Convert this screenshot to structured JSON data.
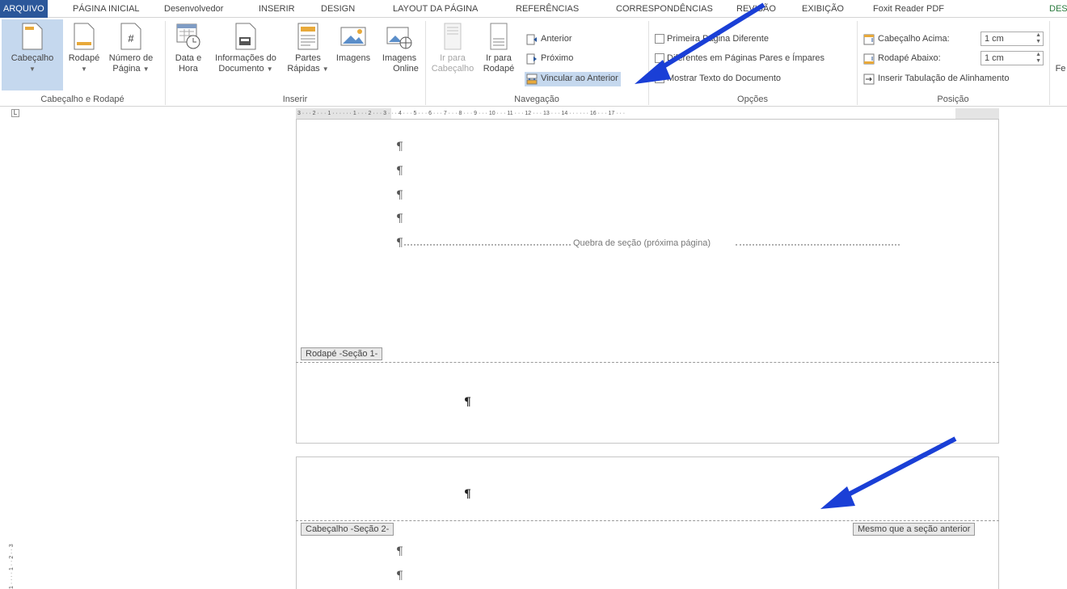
{
  "tabs": [
    "ARQUIVO",
    "PÁGINA INICIAL",
    "Desenvolvedor",
    "INSERIR",
    "DESIGN",
    "LAYOUT DA PÁGINA",
    "REFERÊNCIAS",
    "CORRESPONDÊNCIAS",
    "REVISÃO",
    "EXIBIÇÃO",
    "Foxit Reader PDF",
    "DES"
  ],
  "ribbon": {
    "header_footer_group": {
      "label": "Cabeçalho e Rodapé",
      "header_btn": "Cabeçalho",
      "footer_btn": "Rodapé",
      "page_number_btn_1": "Número de",
      "page_number_btn_2": "Página"
    },
    "insert_group": {
      "label": "Inserir",
      "datetime_1": "Data e",
      "datetime_2": "Hora",
      "docinfo_1": "Informações do",
      "docinfo_2": "Documento",
      "quickparts_1": "Partes",
      "quickparts_2": "Rápidas",
      "images": "Imagens",
      "online_images_1": "Imagens",
      "online_images_2": "Online"
    },
    "navigation_group": {
      "label": "Navegação",
      "goto_header_1": "Ir para",
      "goto_header_2": "Cabeçalho",
      "goto_footer_1": "Ir para",
      "goto_footer_2": "Rodapé",
      "previous": "Anterior",
      "next": "Próximo",
      "link_previous": "Vincular ao Anterior"
    },
    "options_group": {
      "label": "Opções",
      "different_first": "Primeira Página Diferente",
      "different_odd_even": "Diferentes em Páginas Pares e Ímpares",
      "show_doc_text": "Mostrar Texto do Documento"
    },
    "position_group": {
      "label": "Posição",
      "header_from_top": "Cabeçalho Acima:",
      "header_from_top_value": "1 cm",
      "footer_from_bottom": "Rodapé Abaixo:",
      "footer_from_bottom_value": "1 cm",
      "insert_align_tab": "Inserir Tabulação de Alinhamento"
    },
    "close_partial": "Fe"
  },
  "ruler": {
    "corner": "L",
    "ticks": "3 · · · 2 · · · 1 · · ·     · · · 1 · · · 2 · · · 3 · · · 4 · · · 5 · · · 6 · · · 7 · · · 8 · · · 9 · · · 10 · · · 11 · · · 12 · · · 13 · · · 14 · · ·     · · · 16 · · · 17 · · ·",
    "vertical_ticks": "1 · · · · 1 · · 2 · · 3"
  },
  "document": {
    "pilcrow": "¶",
    "section_break": "Quebra de seção (próxima página)",
    "footer_tab": "Rodapé -Seção 1-",
    "header_tab": "Cabeçalho -Seção 2-",
    "same_as_previous": "Mesmo que a seção anterior"
  },
  "colors": {
    "file_tab": "#2b579a",
    "contextual_tab": "#2b7b3e",
    "selected_button": "#c5d8ee",
    "annotation_arrow": "#1a3fd6"
  }
}
